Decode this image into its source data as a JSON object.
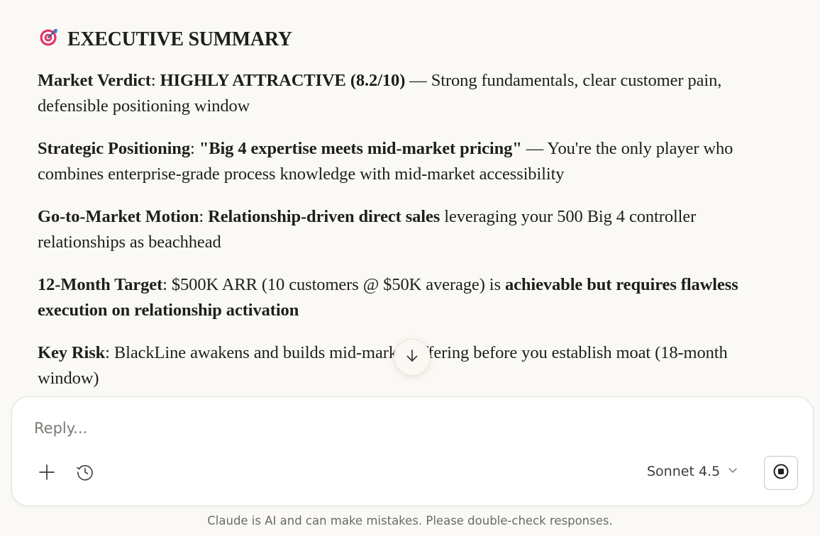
{
  "summary": {
    "heading_icon": "target-icon",
    "heading": "EXECUTIVE SUMMARY",
    "market_verdict": {
      "label": "Market Verdict",
      "sep": ": ",
      "value": "HIGHLY ATTRACTIVE (8.2/10)",
      "text": " — Strong fundamentals, clear customer pain, defensible positioning window"
    },
    "strategic_positioning": {
      "label": "Strategic Positioning",
      "sep": ": ",
      "value": "\"Big 4 expertise meets mid-market pricing\"",
      "text": " — You're the only player who combines enterprise-grade process knowledge with mid-market accessibility"
    },
    "go_to_market": {
      "label": "Go-to-Market Motion",
      "sep": ": ",
      "value": "Relationship-driven direct sales",
      "text": " leveraging your 500 Big 4 controller relationships as beachhead"
    },
    "target": {
      "label": "12-Month Target",
      "text": ": $500K ARR (10 customers @ $50K average) is ",
      "value": "achievable but requires flawless execution on relationship activation"
    },
    "key_risk": {
      "label": "Key Risk",
      "text": ": BlackLine awakens and builds mid-market offering before you establish moat (18-month window)"
    }
  },
  "scroll_button": {
    "icon": "arrow-down-icon"
  },
  "composer": {
    "placeholder": "Reply...",
    "add_icon": "plus-icon",
    "history_icon": "clock-icon",
    "model": "Sonnet 4.5",
    "model_icon": "chevron-down-icon",
    "stop_icon": "stop-icon"
  },
  "disclaimer": "Claude is AI and can make mistakes. Please double-check responses.",
  "colors": {
    "background": "#faf9f5",
    "text": "#1f1e1d",
    "target_red": "#e0356b",
    "target_blue": "#3b82c4"
  }
}
